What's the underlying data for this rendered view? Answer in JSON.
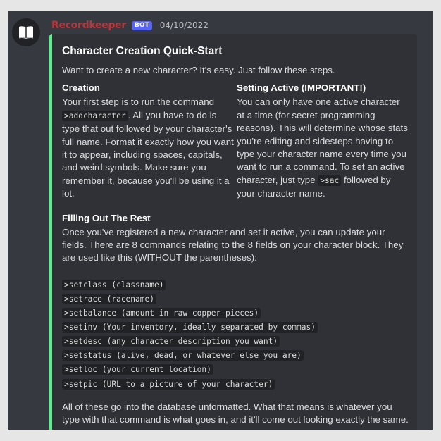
{
  "message": {
    "username": "Recordkeeper",
    "bot_tag": "BOT",
    "timestamp": "04/10/2022",
    "avatar_icon": "book-icon",
    "accent_color": "#57f287",
    "username_color": "#b8363b"
  },
  "embed": {
    "title": "Character Creation Quick-Start",
    "description": "Want to create a new character? It's easy. Just follow these steps.",
    "fields": [
      {
        "name": "Creation",
        "text_before": "Your first step is to run the command ",
        "code": ">addcharacter",
        "text_after": ". All you have to do is type that out followed by your character's full name. Format it exactly how you want it to appear, including spaces, capitals, and weird symbols. Make sure you remember it, because you'll be using it a lot."
      },
      {
        "name": "Setting Active (IMPORTANT!)",
        "text_before": "You can only have one active character at a time (for secret programming reasons). This will determine whose stats you're editing and sidesteps having to type your character name every time you want to run a command. To set an active character, just type ",
        "code": ">sac",
        "text_after": " followed by your character name."
      },
      {
        "name": "Filling Out The Rest",
        "intro": "Once you've registered a new character and set it active, you can update your fields. There are 8 commands relating to the 8 fields on your character block. They are used like this (WITHOUT the parentheses):",
        "commands": [
          ">setclass (classname)",
          ">setrace (racename)",
          ">setbalance (amount in raw copper pieces)",
          ">setinv (Your inventory, ideally separated by commas)",
          ">setdesc (any character description you want)",
          ">setstatus (alive, dead, or whatever else you are)",
          ">setloc (your current location)",
          ">setpic (URL to a picture of your character)"
        ],
        "outro": "All of these go into the database unformatted. What that means is whatever you type with that command is what goes in, and it'll come out looking exactly the same."
      }
    ]
  }
}
